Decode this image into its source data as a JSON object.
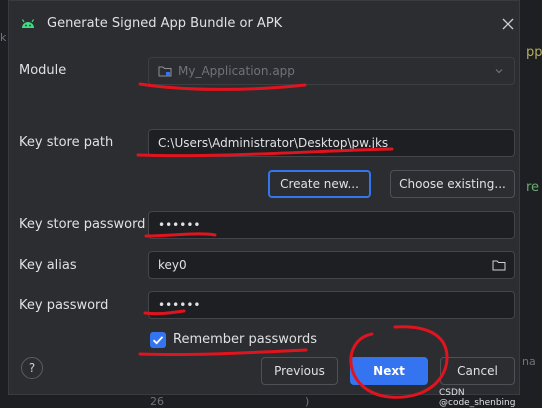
{
  "window": {
    "title": "Generate Signed App Bundle or APK"
  },
  "module": {
    "label": "Module",
    "mnemonic": "M",
    "value": "My_Application.app"
  },
  "keystore": {
    "label": "Key store path",
    "value": "C:\\Users\\Administrator\\Desktop\\pw.jks",
    "create_label": "Create new...",
    "choose_label": "Choose existing..."
  },
  "keystore_password": {
    "label": "Key store password",
    "masked_value": "••••••"
  },
  "key_alias": {
    "label": "Key alias",
    "value": "key0"
  },
  "key_password": {
    "label": "Key password",
    "masked_value": "••••••"
  },
  "remember": {
    "label": "Remember passwords",
    "checked": true
  },
  "footer": {
    "help_label": "?",
    "previous_label": "Previous",
    "next_label": "Next",
    "cancel_label": "Cancel"
  },
  "watermark": "CSDN @code_shenbing",
  "background": {
    "line_number": "26"
  },
  "colors": {
    "accent": "#3574f0",
    "dialog_bg": "#2b2d30",
    "field_bg": "#1e1f22",
    "annotation": "#e0141e"
  },
  "icons": [
    "android-icon",
    "close-icon",
    "folder-icon",
    "chevron-down-icon",
    "check-icon",
    "help-icon"
  ]
}
